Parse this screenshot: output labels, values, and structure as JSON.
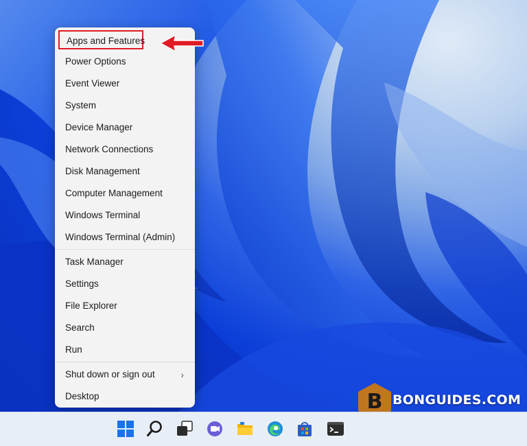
{
  "menu": {
    "group1": [
      {
        "label": "Apps and Features",
        "highlighted": true
      },
      {
        "label": "Power Options"
      },
      {
        "label": "Event Viewer"
      },
      {
        "label": "System"
      },
      {
        "label": "Device Manager"
      },
      {
        "label": "Network Connections"
      },
      {
        "label": "Disk Management"
      },
      {
        "label": "Computer Management"
      },
      {
        "label": "Windows Terminal"
      },
      {
        "label": "Windows Terminal (Admin)"
      }
    ],
    "group2": [
      {
        "label": "Task Manager"
      },
      {
        "label": "Settings"
      },
      {
        "label": "File Explorer"
      },
      {
        "label": "Search"
      },
      {
        "label": "Run"
      }
    ],
    "group3": [
      {
        "label": "Shut down or sign out",
        "submenu": true,
        "chevron": "›"
      },
      {
        "label": "Desktop"
      }
    ]
  },
  "taskbar": {
    "icons": [
      "start-icon",
      "search-icon",
      "task-view-icon",
      "chat-icon",
      "file-explorer-icon",
      "edge-icon",
      "store-icon",
      "terminal-icon"
    ]
  },
  "watermark": {
    "letter": "B",
    "text": "BONGUIDES.COM",
    "color": "#c0751f"
  },
  "colors": {
    "highlight_border": "#e01b24",
    "arrow": "#e01b24",
    "menu_bg": "#f3f3f3"
  }
}
